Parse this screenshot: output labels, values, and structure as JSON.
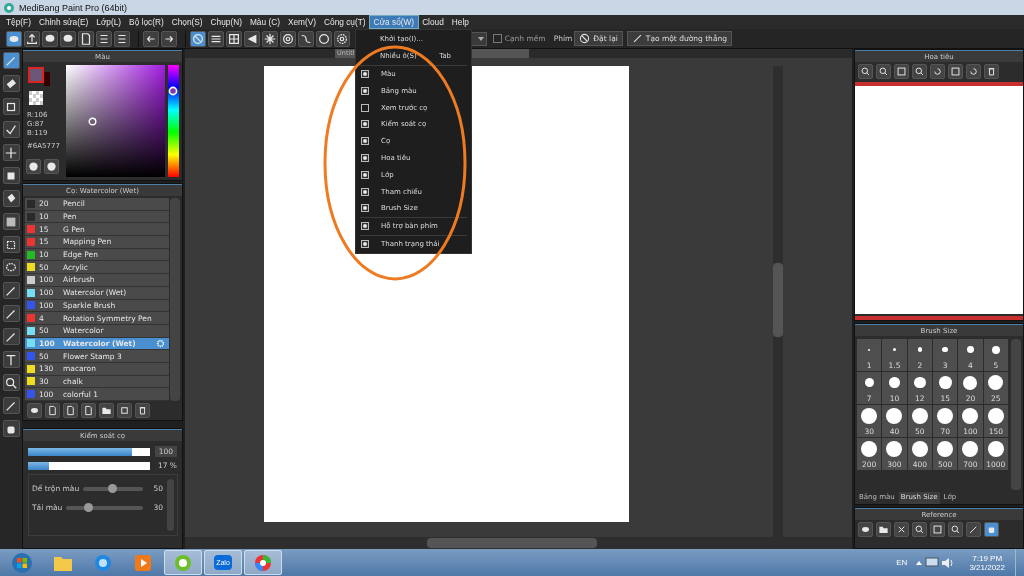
{
  "window": {
    "title": "MediBang Paint Pro (64bit)"
  },
  "menu": [
    {
      "label": "Tệp(F)",
      "selected": false
    },
    {
      "label": "Chỉnh sửa(E)",
      "selected": false
    },
    {
      "label": "Lớp(L)",
      "selected": false
    },
    {
      "label": "Bộ lọc(R)",
      "selected": false
    },
    {
      "label": "Chọn(S)",
      "selected": false
    },
    {
      "label": "Chụp(N)",
      "selected": false
    },
    {
      "label": "Màu (C)",
      "selected": false
    },
    {
      "label": "Xem(V)",
      "selected": false
    },
    {
      "label": "Công cụ(T)",
      "selected": false
    },
    {
      "label": "Cửa sổ(W)",
      "selected": true
    },
    {
      "label": "Cloud",
      "selected": false
    },
    {
      "label": "Help",
      "selected": false
    }
  ],
  "toolbar": {
    "soft_edge": {
      "label": "Cạnh mềm",
      "checked": false
    },
    "keys_label": "Phím",
    "reset_button": "Đặt lại",
    "line_button": "Tạo một đường thẳng"
  },
  "canvas_tab": "Untitl",
  "window_menu": [
    {
      "kind": "command",
      "label": "Khởi tạo(I)..."
    },
    {
      "kind": "command",
      "label": "Nhiều ô(S)",
      "shortcut": "Tab"
    },
    {
      "kind": "separator"
    },
    {
      "kind": "check",
      "label": "Màu",
      "checked": true
    },
    {
      "kind": "check",
      "label": "Bảng màu",
      "checked": true
    },
    {
      "kind": "check",
      "label": "Xem trước cọ",
      "checked": false
    },
    {
      "kind": "check",
      "label": "Kiểm soát cọ",
      "checked": true
    },
    {
      "kind": "check",
      "label": "Cọ",
      "checked": true
    },
    {
      "kind": "check",
      "label": "Hoa tiêu",
      "checked": true
    },
    {
      "kind": "check",
      "label": "Lớp",
      "checked": true
    },
    {
      "kind": "check",
      "label": "Tham chiếu",
      "checked": true
    },
    {
      "kind": "check",
      "label": "Brush Size",
      "checked": true
    },
    {
      "kind": "separator"
    },
    {
      "kind": "check",
      "label": "Hỗ trợ bàn phím",
      "checked": true
    },
    {
      "kind": "separator"
    },
    {
      "kind": "check",
      "label": "Thanh trạng thái",
      "checked": true
    }
  ],
  "color_panel": {
    "title": "Màu",
    "r": "R:106",
    "g": "G:87",
    "b": "B:119",
    "hex": "#6A5777"
  },
  "brush_panel": {
    "title": "Cọ: Watercolor (Wet)",
    "brushes": [
      {
        "size": "20",
        "name": "Pencil",
        "color": "#2a2a2a",
        "selected": false
      },
      {
        "size": "10",
        "name": "Pen",
        "color": "#2a2a2a",
        "selected": false
      },
      {
        "size": "15",
        "name": "G Pen",
        "color": "#ee3333",
        "selected": false
      },
      {
        "size": "15",
        "name": "Mapping Pen",
        "color": "#ee3333",
        "selected": false
      },
      {
        "size": "10",
        "name": "Edge Pen",
        "color": "#22bb22",
        "selected": false
      },
      {
        "size": "50",
        "name": "Acrylic",
        "color": "#eedd22",
        "selected": false
      },
      {
        "size": "100",
        "name": "Airbrush",
        "color": "#cccccc",
        "selected": false
      },
      {
        "size": "100",
        "name": "Watercolor (Wet)",
        "color": "#77ddf0",
        "selected": false
      },
      {
        "size": "100",
        "name": "Sparkle Brush",
        "color": "#3355ee",
        "selected": false
      },
      {
        "size": "4",
        "name": "Rotation Symmetry Pen",
        "color": "#ee3333",
        "selected": false
      },
      {
        "size": "50",
        "name": "Watercolor",
        "color": "#77ddf0",
        "selected": false
      },
      {
        "size": "100",
        "name": "Watercolor (Wet)",
        "color": "#77ddf0",
        "selected": true
      },
      {
        "size": "50",
        "name": "Flower Stamp 3",
        "color": "#3355ee",
        "selected": false
      },
      {
        "size": "130",
        "name": "macaron",
        "color": "#eedd22",
        "selected": false
      },
      {
        "size": "30",
        "name": "chalk",
        "color": "#eedd22",
        "selected": false
      },
      {
        "size": "100",
        "name": "colorful 1",
        "color": "#3355ee",
        "selected": false
      }
    ]
  },
  "brush_control": {
    "title": "Kiểm soát cọ",
    "size": {
      "level": 0.85,
      "reading": "100"
    },
    "opacity": {
      "level": 0.17,
      "reading": "17 %"
    },
    "sliders": [
      {
        "label": "Dể trộn màu",
        "level": 0.5,
        "reading": "50"
      },
      {
        "label": "Tải màu",
        "level": 0.3,
        "reading": "30"
      }
    ]
  },
  "navigator": {
    "title": "Hoa tiêu"
  },
  "brush_size": {
    "title": "Brush Size",
    "sizes": [
      "1",
      "1.5",
      "2",
      "3",
      "4",
      "5",
      "7",
      "10",
      "12",
      "15",
      "20",
      "25",
      "30",
      "40",
      "50",
      "70",
      "100",
      "150",
      "200",
      "300",
      "400",
      "500",
      "700",
      "1000"
    ],
    "tabs": [
      {
        "label": "Bảng màu",
        "selected": false
      },
      {
        "label": "Brush Size",
        "selected": true
      },
      {
        "label": "Lớp",
        "selected": false
      }
    ]
  },
  "reference": {
    "title": "Reference"
  },
  "taskbar": {
    "zalo": "Zalo",
    "language": "EN",
    "time": "7:19 PM",
    "date": "3/21/2022"
  }
}
